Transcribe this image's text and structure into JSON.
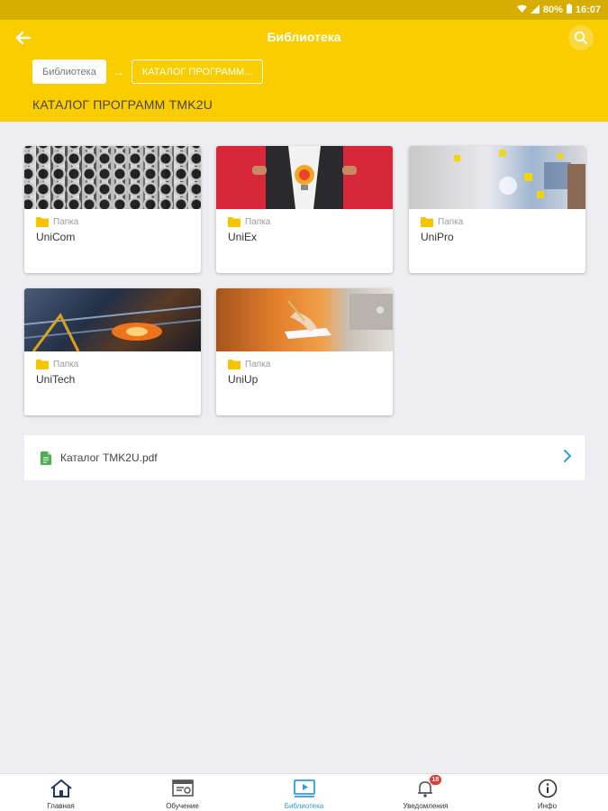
{
  "status_bar": {
    "battery": "80%",
    "time": "16:07"
  },
  "header": {
    "title": "Библиотека",
    "breadcrumbs": [
      "Библиотека",
      "КАТАЛОГ ПРОГРАММ..."
    ],
    "breadcrumb_separator": "→",
    "section_title": "КАТАЛОГ ПРОГРАММ TMK2U",
    "accent_color": "#f9cd00"
  },
  "folders": [
    {
      "type_label": "Папка",
      "name": "UniCom"
    },
    {
      "type_label": "Папка",
      "name": "UniEx"
    },
    {
      "type_label": "Папка",
      "name": "UniPro"
    },
    {
      "type_label": "Папка",
      "name": "UniTech"
    },
    {
      "type_label": "Папка",
      "name": "UniUp"
    }
  ],
  "file": {
    "name": "Каталог TMK2U.pdf",
    "icon": "pdf-file-icon"
  },
  "bottom_nav": {
    "active_color": "#2b9fd7",
    "items": [
      {
        "label": "Главная",
        "icon": "home-icon"
      },
      {
        "label": "Обучение",
        "icon": "training-icon"
      },
      {
        "label": "Библиотека",
        "icon": "library-icon",
        "active": true
      },
      {
        "label": "Уведомления",
        "icon": "notifications-icon",
        "badge": "18"
      },
      {
        "label": "Инфо",
        "icon": "info-icon"
      }
    ]
  }
}
